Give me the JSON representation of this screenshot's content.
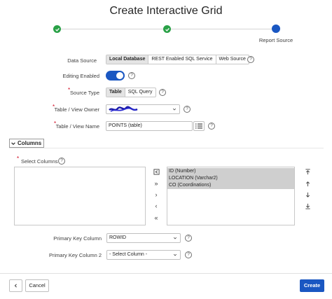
{
  "dialog": {
    "title": "Create Interactive Grid"
  },
  "wizard": {
    "current_step_label": "Report Source"
  },
  "form": {
    "data_source": {
      "label": "Data Source",
      "options": [
        "Local Database",
        "REST Enabled SQL Service",
        "Web Source"
      ],
      "selected": "Local Database"
    },
    "editing_enabled": {
      "label": "Editing Enabled",
      "value": true
    },
    "source_type": {
      "label": "Source Type",
      "options": [
        "Table",
        "SQL Query"
      ],
      "selected": "Table"
    },
    "table_owner": {
      "label": "Table / View Owner"
    },
    "table_name": {
      "label": "Table / View Name",
      "value": "POINTS (table)"
    }
  },
  "columns_region": {
    "title": "Columns",
    "select_columns_label": "Select Columns",
    "left_items": [],
    "right_items": [
      "ID (Number)",
      "LOCATION (Varchar2)",
      "CO (Coordinations)"
    ]
  },
  "primary_key": {
    "pk1_label": "Primary Key Column",
    "pk1_value": "ROWID",
    "pk2_label": "Primary Key Column 2",
    "pk2_value": "- Select Column -"
  },
  "footer": {
    "cancel_label": "Cancel",
    "create_label": "Create"
  },
  "colors": {
    "accent": "#1a57c2",
    "success": "#2aa147",
    "required": "#d0021b"
  },
  "icons": [
    "check-icon",
    "help-icon",
    "chevron-down-icon",
    "list-icon",
    "reset-icon",
    "move-all-icon",
    "move-icon",
    "remove-icon",
    "remove-all-icon",
    "top-icon",
    "up-icon",
    "down-icon",
    "bottom-icon",
    "back-icon"
  ]
}
